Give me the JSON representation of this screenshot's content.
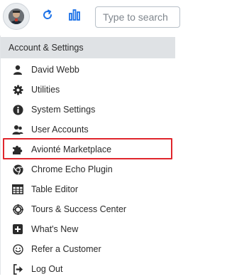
{
  "toolbar": {
    "avatar_icon": "user-avatar",
    "refresh_icon": "refresh-icon",
    "reports_icon": "bar-chart-icon",
    "search_placeholder": "Type to search",
    "colors": {
      "accent": "#1e73e8"
    }
  },
  "menu": {
    "header": "Account & Settings",
    "highlight_color": "#e0262d",
    "items": [
      {
        "label": "David Webb",
        "icon": "user-icon"
      },
      {
        "label": "Utilities",
        "icon": "gear-icon"
      },
      {
        "label": "System Settings",
        "icon": "info-icon"
      },
      {
        "label": "User Accounts",
        "icon": "users-icon"
      },
      {
        "label": "Avionté Marketplace",
        "icon": "puzzle-icon"
      },
      {
        "label": "Chrome Echo Plugin",
        "icon": "chrome-icon"
      },
      {
        "label": "Table Editor",
        "icon": "table-icon"
      },
      {
        "label": "Tours & Success Center",
        "icon": "lifebuoy-icon"
      },
      {
        "label": "What's New",
        "icon": "plus-square-icon"
      },
      {
        "label": "Refer a Customer",
        "icon": "smile-icon"
      },
      {
        "label": "Log Out",
        "icon": "logout-icon"
      }
    ]
  }
}
